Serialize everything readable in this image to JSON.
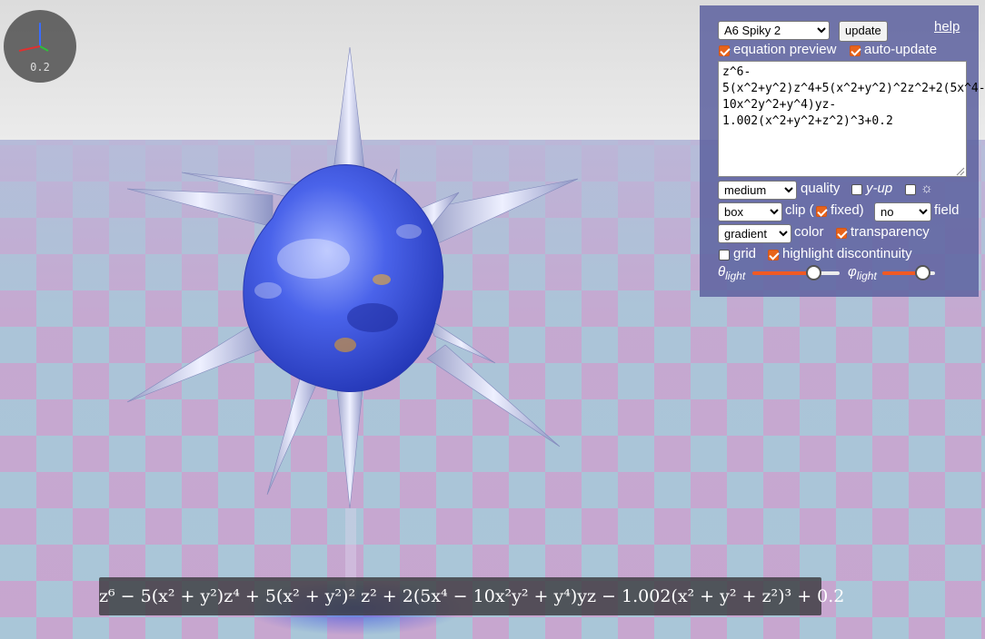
{
  "axis_widget": {
    "scale_label": "0.2"
  },
  "panel": {
    "preset_select": {
      "value": "A6 Spiky 2",
      "options": [
        "A6 Spiky 2"
      ]
    },
    "update_button": "update",
    "help_link": "help",
    "equation_preview": {
      "label": "equation preview",
      "checked": true
    },
    "auto_update": {
      "label": "auto-update",
      "checked": true
    },
    "equation_text": "z^6-5(x^2+y^2)z^4+5(x^2+y^2)^2z^2+2(5x^4-10x^2y^2+y^4)yz-1.002(x^2+y^2+z^2)^3+0.2",
    "quality": {
      "value": "medium",
      "label": "quality"
    },
    "y_up": {
      "label": "y-up",
      "checked": false
    },
    "light_toggle": {
      "label": "☼",
      "checked": false
    },
    "clip": {
      "value": "box",
      "label": "clip (",
      "fixed_label": "fixed)",
      "fixed_checked": true
    },
    "field": {
      "value": "no",
      "label": "field"
    },
    "color": {
      "value": "gradient",
      "label": "color"
    },
    "transparency": {
      "label": "transparency",
      "checked": true
    },
    "grid": {
      "label": "grid",
      "checked": false
    },
    "highlight_discontinuity": {
      "label": "highlight discontinuity",
      "checked": true
    },
    "theta_light": {
      "symbol": "θ",
      "sub": "light",
      "value": 0.73
    },
    "phi_light": {
      "symbol": "φ",
      "sub": "light",
      "value": 0.74
    }
  },
  "equation_preview_bar": "z⁶ − 5(x² + y²)z⁴ + 5(x² + y²)² z² + 2(5x⁴ − 10x²y² + y⁴)yz − 1.002(x² + y² + z²)³ + 0.2",
  "colors": {
    "accent": "#e8641b",
    "panel_bg": "#6064a0",
    "floor_pink": "#c7a6cf",
    "floor_blue": "#a9c6d8",
    "surface_blue": "#3c58e6",
    "slider_fill": "#f05a24"
  },
  "icons": [
    "axis-gizmo-icon",
    "dropdown-chevron-icon",
    "checkmark-icon",
    "sun-icon",
    "resize-grip-icon"
  ]
}
